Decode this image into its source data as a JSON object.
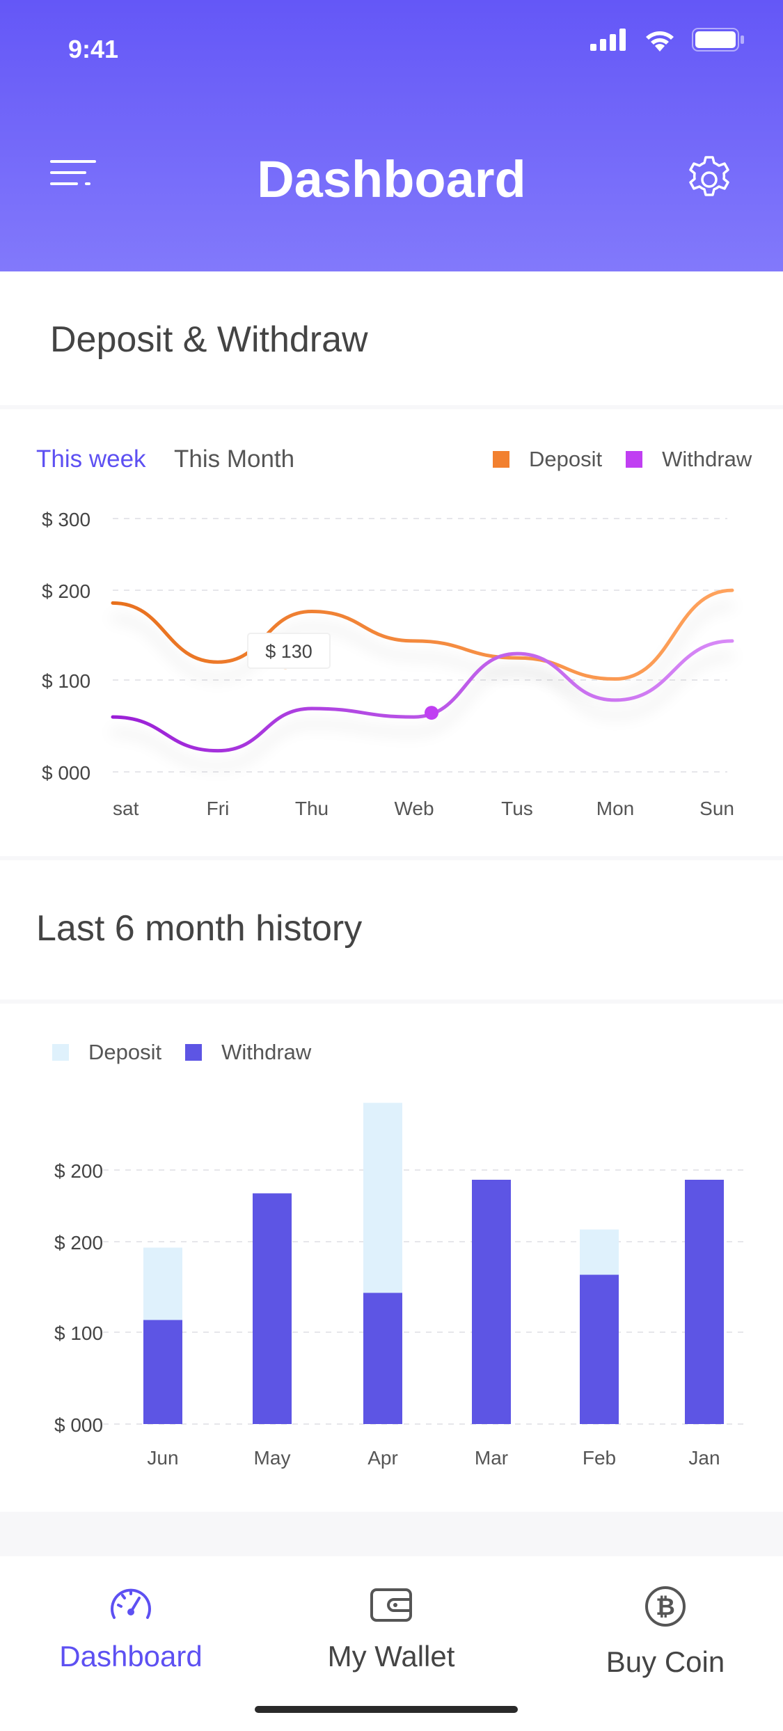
{
  "status_bar": {
    "time": "9:41"
  },
  "header": {
    "title": "Dashboard"
  },
  "section1": {
    "title": "Deposit & Withdraw"
  },
  "line_card": {
    "tabs": [
      {
        "label": "This week",
        "active": true
      },
      {
        "label": "This Month",
        "active": false
      }
    ],
    "legend": [
      {
        "label": "Deposit",
        "color": "#f2802f"
      },
      {
        "label": "Withdraw",
        "color": "#c03ff2"
      }
    ],
    "tooltip": "$ 130"
  },
  "section2": {
    "title": "Last 6 month history"
  },
  "bar_card": {
    "legend": [
      {
        "label": "Deposit",
        "color": "#dff1fc"
      },
      {
        "label": "Withdraw",
        "color": "#5d55e4"
      }
    ]
  },
  "chart_data": [
    {
      "type": "line",
      "title": "Deposit & Withdraw",
      "categories": [
        "sat",
        "Fri",
        "Thu",
        "Web",
        "Tus",
        "Mon",
        "Sun"
      ],
      "y_tick_labels": [
        "$ 000",
        "$ 100",
        "$ 200",
        "$ 300"
      ],
      "ylim": [
        0,
        300
      ],
      "grid": true,
      "legend_position": "top-right",
      "series": [
        {
          "name": "Deposit",
          "color": "#f2802f",
          "values": [
            200,
            130,
            190,
            155,
            135,
            110,
            215
          ]
        },
        {
          "name": "Withdraw",
          "color": "#c03ff2",
          "values": [
            65,
            25,
            75,
            65,
            140,
            85,
            155
          ]
        }
      ],
      "highlights": [
        {
          "series": "Deposit",
          "x": "Thu",
          "value": 130
        },
        {
          "series": "Withdraw",
          "x": "Web",
          "value": 70
        }
      ]
    },
    {
      "type": "bar",
      "title": "Last 6 month history",
      "categories": [
        "Jun",
        "May",
        "Apr",
        "Mar",
        "Feb",
        "Jan"
      ],
      "y_tick_labels": [
        "$ 000",
        "$ 100",
        "$ 200",
        "$ 200"
      ],
      "grid": true,
      "legend_position": "top-left",
      "series": [
        {
          "name": "Deposit",
          "color": "#dff1fc",
          "values": [
            195,
            240,
            355,
            270,
            215,
            240
          ]
        },
        {
          "name": "Withdraw",
          "color": "#5d55e4",
          "values": [
            115,
            255,
            145,
            270,
            165,
            270
          ]
        }
      ]
    }
  ],
  "bottom_nav": {
    "items": [
      {
        "label": "Dashboard",
        "icon": "speedometer-icon",
        "active": true
      },
      {
        "label": "My Wallet",
        "icon": "wallet-icon",
        "active": false
      },
      {
        "label": "Buy Coin",
        "icon": "bitcoin-icon",
        "active": false
      }
    ]
  }
}
